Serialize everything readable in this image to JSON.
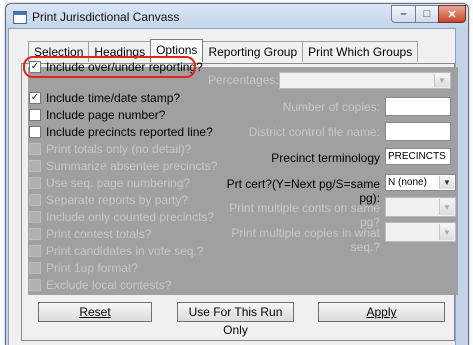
{
  "window": {
    "title": "Print Jurisdictional Canvass"
  },
  "tabs": [
    "Selection",
    "Headings",
    "Options",
    "Reporting Group",
    "Print Which Groups"
  ],
  "active_tab": "Options",
  "options": [
    {
      "label": "Include over/under reporting?",
      "checked": true,
      "enabled": true
    },
    {
      "label": "Include time/date stamp?",
      "checked": true,
      "enabled": true
    },
    {
      "label": "Include page number?",
      "checked": false,
      "enabled": true
    },
    {
      "label": "Include precincts reported line?",
      "checked": false,
      "enabled": true
    },
    {
      "label": "Print totals only (no detail)?",
      "checked": false,
      "enabled": false
    },
    {
      "label": "Summarize absentee precincts?",
      "checked": false,
      "enabled": false
    },
    {
      "label": "Use seq. page numbering?",
      "checked": false,
      "enabled": false
    },
    {
      "label": "Separate reports by party?",
      "checked": false,
      "enabled": false
    },
    {
      "label": "Include only counted precincts?",
      "checked": false,
      "enabled": false
    },
    {
      "label": "Print contest totals?",
      "checked": false,
      "enabled": false
    },
    {
      "label": "Print candidates in vote seq.?",
      "checked": false,
      "enabled": false
    },
    {
      "label": "Print 1up format?",
      "checked": false,
      "enabled": false
    },
    {
      "label": "Exclude local contests?",
      "checked": false,
      "enabled": false
    }
  ],
  "right": {
    "percentages_label": "Percentages:",
    "copies_label": "Number of copies:",
    "district_file_label": "District control file name:",
    "precinct_term_label": "Precinct terminology",
    "precinct_term_value": "PRECINCTS",
    "prt_cert_label": "Prt cert?(Y=Next pg/S=same pg):",
    "prt_cert_value": "N (none)",
    "multi_conts_label": "Print multiple conts on same pg?",
    "multi_copies_label": "Print multiple copies in what seq.?"
  },
  "buttons": {
    "reset": "Reset",
    "use_for_run": "Use For This Run Only",
    "apply": "Apply"
  },
  "colors": {
    "highlight": "#e1251b"
  }
}
